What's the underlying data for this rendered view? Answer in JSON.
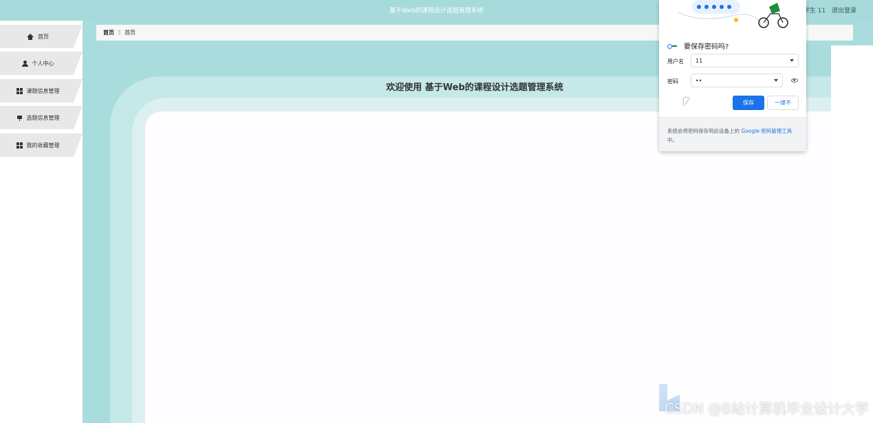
{
  "header": {
    "title": "基于Web的课程设计选题管理系统",
    "user_label": "学生 11",
    "logout_label": "退出登录"
  },
  "sidebar": {
    "items": [
      {
        "label": "首页",
        "icon": "home-icon"
      },
      {
        "label": "个人中心",
        "icon": "user-icon"
      },
      {
        "label": "课题信息管理",
        "icon": "grid-icon"
      },
      {
        "label": "选题信息管理",
        "icon": "pin-icon"
      },
      {
        "label": "我的收藏管理",
        "icon": "grid-icon"
      }
    ]
  },
  "breadcrumb": {
    "root": "首页",
    "separator": "Ξ",
    "current": "首页"
  },
  "main": {
    "welcome": "欢迎使用 基于Web的课程设计选题管理系统"
  },
  "password_popup": {
    "title": "要保存密码吗?",
    "username_label": "用户名",
    "username_value": "11",
    "password_label": "密码",
    "password_value": "••",
    "save_label": "保存",
    "never_label": "一律不",
    "footer_text": "系统会将密码保存到此设备上的",
    "footer_link": "Google 密码管理工具",
    "footer_suffix": "中。"
  },
  "watermark": "CSDN @B站计算机毕业设计大学",
  "colors": {
    "header_bg": "#a7dadb",
    "main_bg": "#a9dcdc",
    "accent_blue": "#1a73e8"
  }
}
